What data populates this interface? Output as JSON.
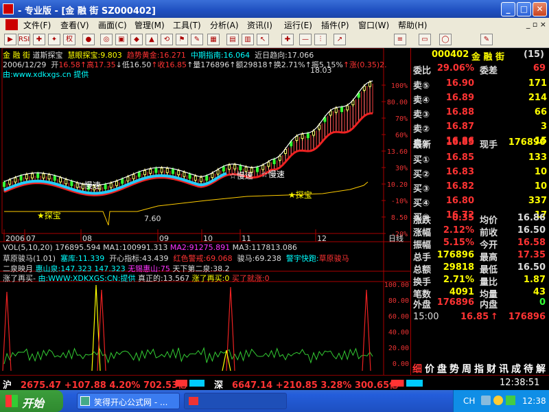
{
  "window": {
    "title": "- 专业版 - [金 融 街 SZ000402]",
    "buttons": [
      "_",
      "□",
      "✕"
    ]
  },
  "menu": {
    "items": [
      "文件(F)",
      "查看(V)",
      "画面(C)",
      "管理(M)",
      "工具(T)",
      "分析(A)",
      "资讯(I)",
      "运行(E)",
      "插件(P)",
      "窗口(W)",
      "帮助(H)"
    ],
    "mdi_buttons": "_ ▫ ×"
  },
  "toolbar": {
    "items": [
      "▶",
      "RSI",
      "✚",
      "✦",
      "权",
      "●",
      "◎",
      "▣",
      "◆",
      "▲",
      "⟲",
      "⚑",
      "✎",
      "▦",
      "▤",
      "▥",
      "↖",
      "✚",
      "—",
      "⫶",
      "↗",
      "≡",
      "▭",
      "◯",
      "✎"
    ]
  },
  "indicators": {
    "line1": [
      {
        "t": "金 融 街",
        "c": "yel"
      },
      {
        "t": " 道斯探宝",
        "c": "wht"
      },
      {
        "t": "  慧眼探宝:",
        "c": "yel"
      },
      {
        "t": "9.803",
        "c": "yel"
      },
      {
        "t": "  趋势黄金:",
        "c": "red"
      },
      {
        "t": "16.271",
        "c": "red"
      },
      {
        "t": "  中期指南:",
        "c": "cyan"
      },
      {
        "t": "16.064",
        "c": "cyan"
      },
      {
        "t": "  近日趋向:",
        "c": "wht"
      },
      {
        "t": "17.066",
        "c": "wht"
      }
    ],
    "line2": [
      {
        "t": "2006/12/29",
        "c": "wht"
      },
      {
        "t": "  开",
        "c": "wht"
      },
      {
        "t": "16.58",
        "c": "red"
      },
      {
        "t": "↑高",
        "c": "red"
      },
      {
        "t": "17.35",
        "c": "red"
      },
      {
        "t": "↓低",
        "c": "wht"
      },
      {
        "t": "16.50",
        "c": "wht"
      },
      {
        "t": "↑收",
        "c": "red"
      },
      {
        "t": "16.85",
        "c": "red"
      },
      {
        "t": "↑量",
        "c": "wht"
      },
      {
        "t": "176896",
        "c": "wht"
      },
      {
        "t": "↑额",
        "c": "wht"
      },
      {
        "t": "29818",
        "c": "wht"
      },
      {
        "t": "↑换",
        "c": "wht"
      },
      {
        "t": "2.71%",
        "c": "wht"
      },
      {
        "t": "↑振",
        "c": "wht"
      },
      {
        "t": "5.15%",
        "c": "wht"
      },
      {
        "t": "↑涨",
        "c": "red"
      },
      {
        "t": "(0.35)",
        "c": "red"
      },
      {
        "t": "2.",
        "c": "red"
      }
    ],
    "line3": [
      {
        "t": "由:www.xdkxgs.cn 提供",
        "c": "cyan"
      }
    ]
  },
  "chart": {
    "high_label": "18.03",
    "low_label": "7.60",
    "markers": [
      "☆慢速",
      "☆慢速",
      "☆慢速",
      "★探宝",
      "★探宝"
    ],
    "x_labels": [
      "2006",
      "07",
      "08",
      "09",
      "10",
      "11",
      "12"
    ],
    "y_pct": [
      "100%",
      "80.00",
      "70%",
      "60%",
      "13.60",
      "30%",
      "10.20",
      "-10%",
      "8.50",
      "-20%"
    ],
    "period": "日线"
  },
  "vol_line": [
    {
      "t": "VOL(5,10,20) ",
      "c": "wht"
    },
    {
      "t": "176895.594 ",
      "c": "wht"
    },
    {
      "t": "MA1:",
      "c": "wht"
    },
    {
      "t": "100991.313 ",
      "c": "wht"
    },
    {
      "t": "MA2:",
      "c": "mag"
    },
    {
      "t": "91275.891 ",
      "c": "mag"
    },
    {
      "t": "MA3:",
      "c": "wht"
    },
    {
      "t": "117813.086",
      "c": "wht"
    }
  ],
  "sub_lines": [
    [
      {
        "t": "草原骏马(1.01)  ",
        "c": "wht"
      },
      {
        "t": "塞库:11.339",
        "c": "cyan"
      },
      {
        "t": "  开心指标:43.439",
        "c": "wht"
      },
      {
        "t": "  红色警戒:69.068",
        "c": "red"
      },
      {
        "t": "  骏马:69.238",
        "c": "wht"
      },
      {
        "t": "  警宇快跑:",
        "c": "cyan"
      },
      {
        "t": "草原骏马",
        "c": "red"
      }
    ],
    [
      {
        "t": "二泉映月 ",
        "c": "wht"
      },
      {
        "t": "惠山泉:147.323 ",
        "c": "cyan"
      },
      {
        "t": "147.323 ",
        "c": "cyan"
      },
      {
        "t": "无锡惠山:75 ",
        "c": "mag"
      },
      {
        "t": "天下第二泉:38.2",
        "c": "wht"
      }
    ]
  ],
  "bottom_line": [
    {
      "t": "涨了再买- ",
      "c": "wht"
    },
    {
      "t": "由:WWW:XDKXGS:CN:提供 ",
      "c": "cyan"
    },
    {
      "t": "真正的:13.567 ",
      "c": "wht"
    },
    {
      "t": "涨了再买:0 ",
      "c": "yel"
    },
    {
      "t": "买了就涨:0",
      "c": "red"
    }
  ],
  "bottom_axis": [
    "100.00",
    "80.00",
    "60.00",
    "40.00",
    "20.00",
    "0.00"
  ],
  "quote": {
    "code": "000402",
    "name": "金 融 街",
    "count": "(15)",
    "webi_label": "委比",
    "webi": "29.06%",
    "wcha_label": "委差",
    "wcha": "69",
    "sells": [
      {
        "l": "卖⑤",
        "p": "16.90",
        "v": "171"
      },
      {
        "l": "卖④",
        "p": "16.89",
        "v": "214"
      },
      {
        "l": "卖③",
        "p": "16.88",
        "v": "66"
      },
      {
        "l": "卖②",
        "p": "16.87",
        "v": "3"
      },
      {
        "l": "卖①",
        "p": "16.86",
        "v": "15"
      }
    ],
    "latest_label": "最新",
    "latest": "16.85",
    "nowhand_label": "现手",
    "nowhand": "176896",
    "buys": [
      {
        "l": "买①",
        "p": "16.85",
        "v": "133"
      },
      {
        "l": "买②",
        "p": "16.83",
        "v": "10"
      },
      {
        "l": "买③",
        "p": "16.82",
        "v": "10"
      },
      {
        "l": "买④",
        "p": "16.80",
        "v": "337"
      },
      {
        "l": "买⑤",
        "p": "16.72",
        "v": "17"
      }
    ],
    "stats": [
      {
        "l1": "涨跌",
        "v1": "0.35",
        "c1": "red",
        "l2": "均价",
        "v2": "16.86",
        "c2": "wht"
      },
      {
        "l1": "涨幅",
        "v1": "2.12%",
        "c1": "red",
        "l2": "前收",
        "v2": "16.50",
        "c2": "wht"
      },
      {
        "l1": "振幅",
        "v1": "5.15%",
        "c1": "red",
        "l2": "今开",
        "v2": "16.58",
        "c2": "red"
      },
      {
        "l1": "总手",
        "v1": "176896",
        "c1": "yel",
        "l2": "最高",
        "v2": "17.35",
        "c2": "red"
      },
      {
        "l1": "总额",
        "v1": "29818",
        "c1": "yel",
        "l2": "最低",
        "v2": "16.50",
        "c2": "wht"
      },
      {
        "l1": "换手",
        "v1": "2.71%",
        "c1": "yel",
        "l2": "量比",
        "v2": "1.87",
        "c2": "yel"
      },
      {
        "l1": "笔数",
        "v1": "4091",
        "c1": "yel",
        "l2": "均量",
        "v2": "43",
        "c2": "yel"
      }
    ],
    "outer_label": "外盘",
    "outer": "176896",
    "inner_label": "内盘",
    "inner": "0",
    "tick_time": "15:00",
    "tick_price": "16.85",
    "tick_arrow": "↑",
    "tick_vol": "176896",
    "tabs": [
      "细",
      "价",
      "盘",
      "势",
      "周",
      "指",
      "财",
      "讯",
      "成",
      "待",
      "解"
    ]
  },
  "index": {
    "sh_label": "沪",
    "sh": "2675.47 +107.88 4.20% 702.53亿",
    "sz_label": "深",
    "sz": "6647.14 +210.85 3.28% 300.65亿",
    "clock": "12:38:51"
  },
  "taskbar": {
    "start": "开始",
    "items": [
      "笑得开心公式网 - ...",
      ""
    ],
    "lang": "CH",
    "time": "12:38"
  }
}
